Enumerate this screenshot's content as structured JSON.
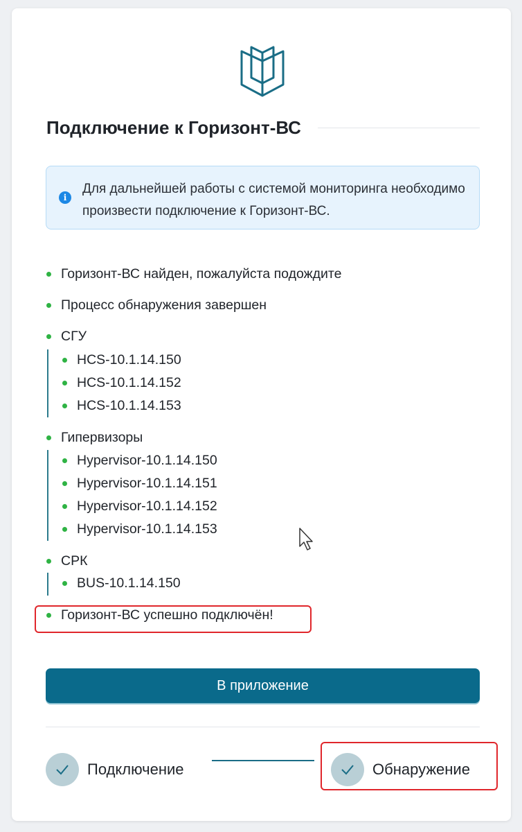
{
  "title": "Подключение к Горизонт-ВС",
  "info": {
    "icon": "info-icon",
    "text": "Для дальнейшей работы с системой мониторинга необходимо произвести подключение к Горизонт-ВС."
  },
  "log": {
    "found": "Горизонт-ВС найден, пожалуйста подождите",
    "discovery_done": "Процесс обнаружения завершен",
    "groups": [
      {
        "label": "СГУ",
        "items": [
          "HCS-10.1.14.150",
          "HCS-10.1.14.152",
          "HCS-10.1.14.153"
        ]
      },
      {
        "label": "Гипервизоры",
        "items": [
          "Hypervisor-10.1.14.150",
          "Hypervisor-10.1.14.151",
          "Hypervisor-10.1.14.152",
          "Hypervisor-10.1.14.153"
        ]
      },
      {
        "label": "СРК",
        "items": [
          "BUS-10.1.14.150"
        ]
      }
    ],
    "success": "Горизонт-ВС успешно подключён!"
  },
  "buttons": {
    "to_app": "В приложение"
  },
  "steps": [
    {
      "label": "Подключение",
      "icon": "check-icon",
      "status": "done"
    },
    {
      "label": "Обнаружение",
      "icon": "check-icon",
      "status": "done"
    }
  ],
  "colors": {
    "primary": "#0a6a8b",
    "status_dot": "#2fb344",
    "info_bg": "#e7f3fd",
    "info_icon": "#1d88e5",
    "highlight": "#e0262b"
  }
}
